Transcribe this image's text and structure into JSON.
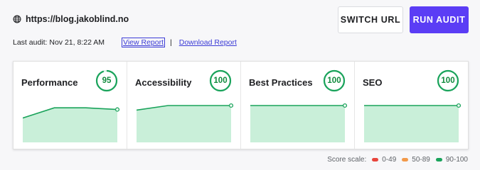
{
  "header": {
    "url": "https://blog.jakoblind.no",
    "switch_url_label": "SWITCH URL",
    "run_audit_label": "RUN AUDIT"
  },
  "meta": {
    "last_audit": "Last audit: Nov 21, 8:22 AM",
    "view_report": "View Report",
    "separator": "|",
    "download_report": "Download Report"
  },
  "cards": [
    {
      "title": "Performance",
      "score": "95",
      "score_fraction": 0.95,
      "trend": [
        78,
        96,
        96,
        93
      ]
    },
    {
      "title": "Accessibility",
      "score": "100",
      "score_fraction": 1.0,
      "trend": [
        92,
        100,
        100,
        100
      ]
    },
    {
      "title": "Best Practices",
      "score": "100",
      "score_fraction": 1.0,
      "trend": [
        100,
        100,
        100,
        100
      ]
    },
    {
      "title": "SEO",
      "score": "100",
      "score_fraction": 1.0,
      "trend": [
        100,
        100,
        100,
        100
      ]
    }
  ],
  "legend": {
    "label": "Score scale:",
    "ranges": [
      {
        "text": "0-49",
        "color": "#e8453c"
      },
      {
        "text": "50-89",
        "color": "#f2994a"
      },
      {
        "text": "90-100",
        "color": "#1aa35b"
      }
    ]
  },
  "colors": {
    "accent": "#5b3df5",
    "good": "#1aa35b",
    "good_fill": "#c9efd9",
    "link": "#3b3bd6"
  }
}
